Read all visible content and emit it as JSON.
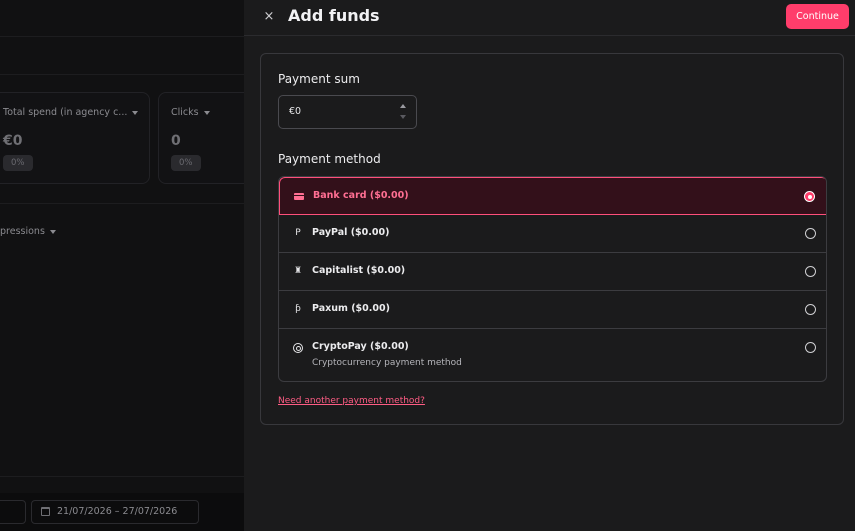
{
  "background": {
    "cards": [
      {
        "title": "Total spend (in agency c...",
        "value": "€0",
        "badge": "0%"
      },
      {
        "title": "Clicks",
        "value": "0",
        "badge": "0%"
      }
    ],
    "impressions_label": "pressions",
    "date_range": "21/07/2026 – 27/07/2026"
  },
  "panel": {
    "close_icon": "×",
    "title": "Add funds",
    "continue_label": "Continue",
    "payment_sum_label": "Payment sum",
    "payment_sum_value": "€0",
    "payment_method_label": "Payment method",
    "methods": [
      {
        "label": "Bank card ($0.00)",
        "icon": "credit-card-icon",
        "selected": true
      },
      {
        "label": "PayPal ($0.00)",
        "icon": "paypal-icon",
        "glyph": "P",
        "selected": false
      },
      {
        "label": "Capitalist ($0.00)",
        "icon": "capitalist-icon",
        "glyph": "♜",
        "selected": false
      },
      {
        "label": "Paxum ($0.00)",
        "icon": "paxum-icon",
        "glyph": "ƥ",
        "selected": false
      },
      {
        "label": "CryptoPay ($0.00)",
        "sub": "Cryptocurrency payment method",
        "icon": "crypto-icon",
        "selected": false
      }
    ],
    "need_another_link": "Need another payment method?"
  },
  "colors": {
    "accent": "#ff3d6b",
    "selected_bg": "#33101a",
    "panel_bg": "#1b1b1c"
  }
}
